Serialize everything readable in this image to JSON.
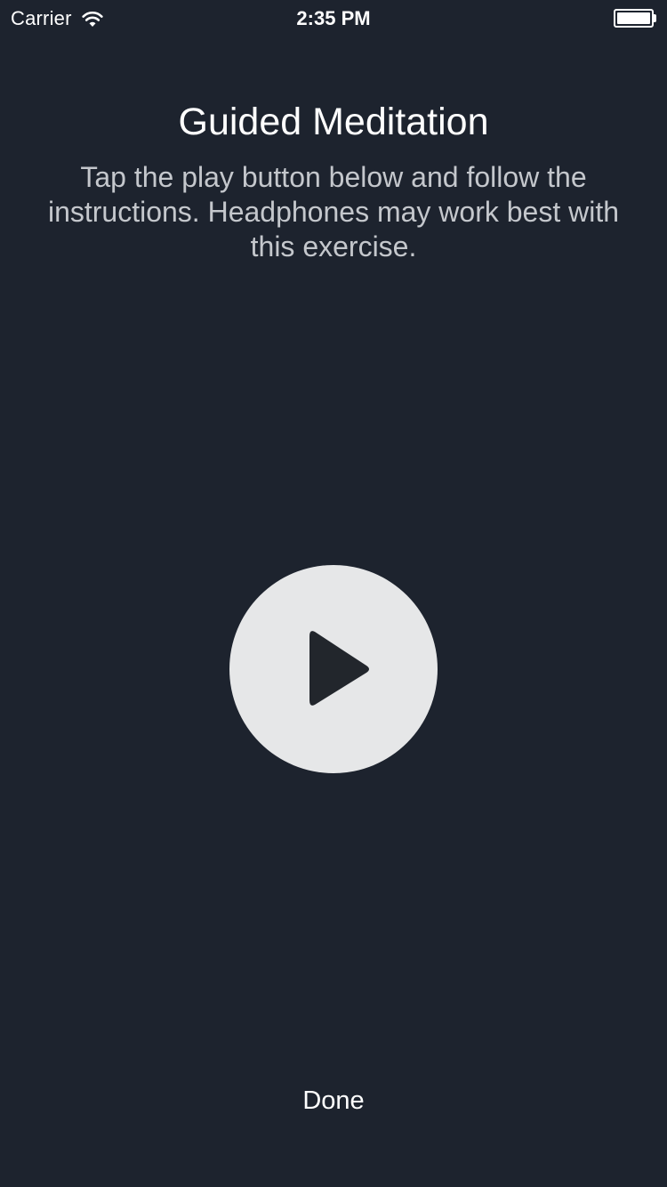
{
  "status_bar": {
    "carrier": "Carrier",
    "time": "2:35 PM",
    "wifi_icon": "wifi-icon",
    "battery_icon": "battery-icon",
    "battery_level": 1.0
  },
  "screen": {
    "title": "Guided Meditation",
    "instructions": "Tap the play button below and follow the instructions.  Headphones may work best with this exercise.",
    "play_icon": "play-icon",
    "done_label": "Done"
  },
  "colors": {
    "background": "#1d232e",
    "title_text": "#ffffff",
    "body_text": "#c4c7cc",
    "play_button_bg": "#e6e7e8",
    "play_icon": "#22262c"
  }
}
